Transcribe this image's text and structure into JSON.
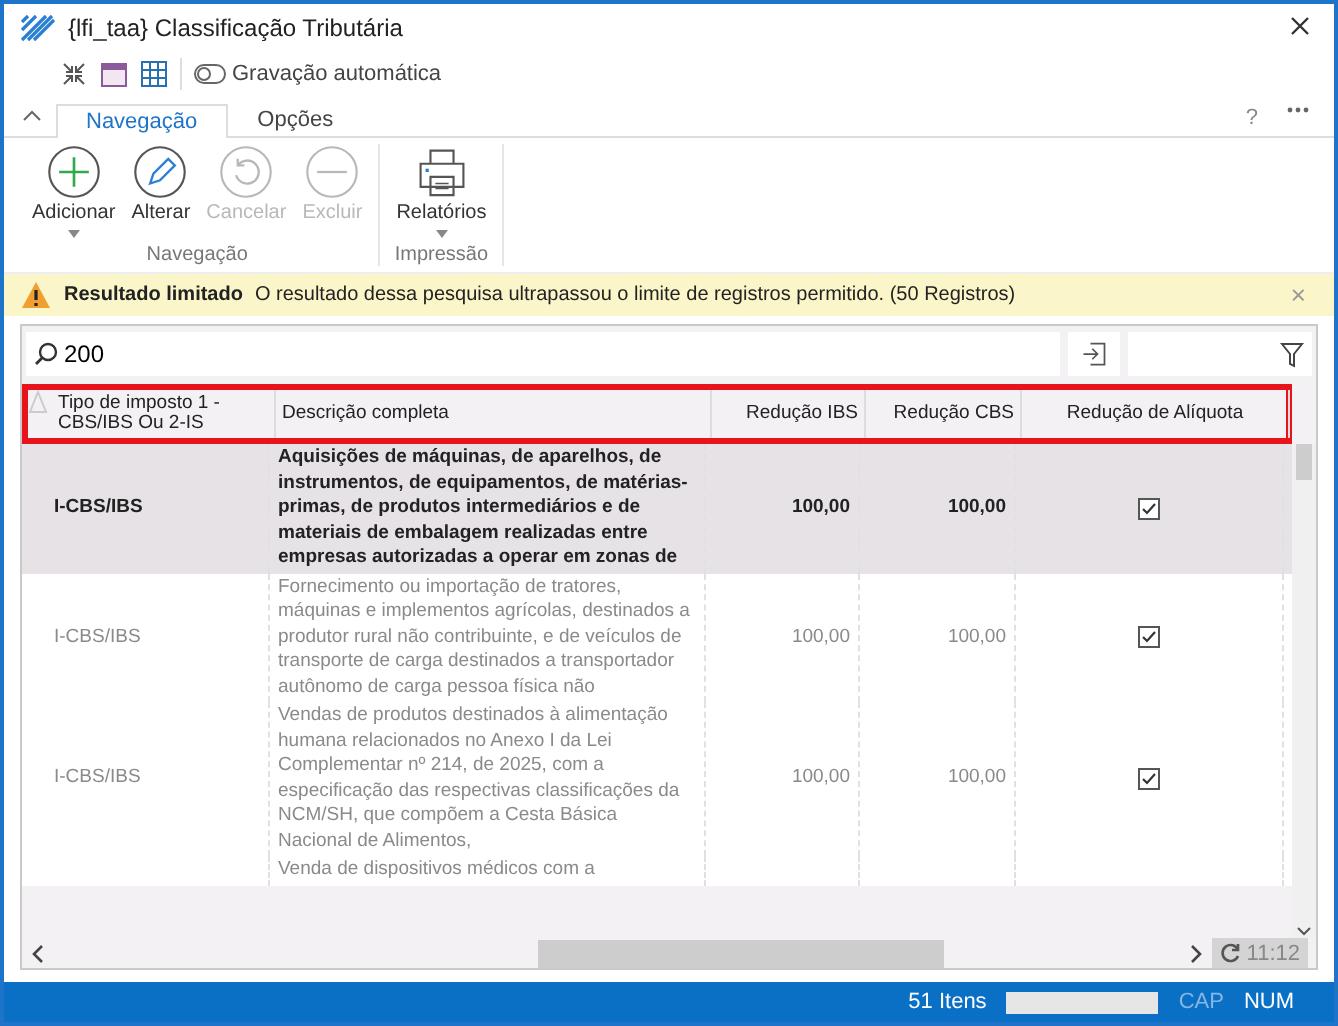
{
  "window": {
    "title": "{lfi_taa}  Classificação Tributária"
  },
  "quick_toolbar": {
    "autosave_label": "Gravação automática"
  },
  "help": "?",
  "tabs": [
    {
      "label": "Navegação",
      "selected": true
    },
    {
      "label": "Opções",
      "selected": false
    }
  ],
  "ribbon": {
    "groups": [
      {
        "label": "Navegação",
        "buttons": [
          {
            "label": "Adicionar",
            "kind": "add",
            "disabled": false,
            "dropdown": true
          },
          {
            "label": "Alterar",
            "kind": "edit",
            "disabled": false,
            "dropdown": false
          },
          {
            "label": "Cancelar",
            "kind": "undo",
            "disabled": true,
            "dropdown": false
          },
          {
            "label": "Excluir",
            "kind": "remove",
            "disabled": true,
            "dropdown": false
          }
        ]
      },
      {
        "label": "Impressão",
        "buttons": [
          {
            "label": "Relatórios",
            "kind": "print",
            "disabled": false,
            "dropdown": true
          }
        ]
      }
    ]
  },
  "banner": {
    "title": "Resultado limitado",
    "message": "O resultado dessa pesquisa ultrapassou o limite de registros permitido. (50 Registros)",
    "close": "×"
  },
  "search": {
    "value": "200"
  },
  "table": {
    "columns": [
      "Tipo de imposto 1 - CBS/IBS Ou 2-IS",
      "Descrição completa",
      "Redução IBS",
      "Redução CBS",
      "Redução de Alíquota"
    ],
    "rows": [
      {
        "tipo": "I-CBS/IBS",
        "descricao": "Aquisições de máquinas, de aparelhos, de instrumentos, de equipamentos, de matérias-primas, de produtos intermediários e de materiais de embalagem realizadas entre empresas autorizadas a operar em zonas de",
        "reducao_ibs": "100,00",
        "reducao_cbs": "100,00",
        "reducao_aliquota": true,
        "selected": true
      },
      {
        "tipo": "I-CBS/IBS",
        "descricao": "Fornecimento ou importação de tratores, máquinas e implementos agrícolas, destinados a produtor rural não contribuinte, e de veículos de transporte de carga destinados a transportador autônomo de carga pessoa física não",
        "reducao_ibs": "100,00",
        "reducao_cbs": "100,00",
        "reducao_aliquota": true,
        "selected": false
      },
      {
        "tipo": "I-CBS/IBS",
        "descricao": "Vendas de produtos destinados à alimentação humana relacionados no Anexo I da Lei Complementar nº 214, de 2025, com a especificação das respectivas classificações da NCM/SH, que compõem a Cesta Básica Nacional de Alimentos,",
        "reducao_ibs": "100,00",
        "reducao_cbs": "100,00",
        "reducao_aliquota": true,
        "selected": false
      },
      {
        "descricao": "Venda de dispositivos médicos com a",
        "selected": false
      }
    ]
  },
  "refresh_time": "11:12",
  "status_bar": {
    "count": "51 Itens",
    "cap": {
      "label": "CAP",
      "on": false
    },
    "num": {
      "label": "NUM",
      "on": true
    }
  }
}
